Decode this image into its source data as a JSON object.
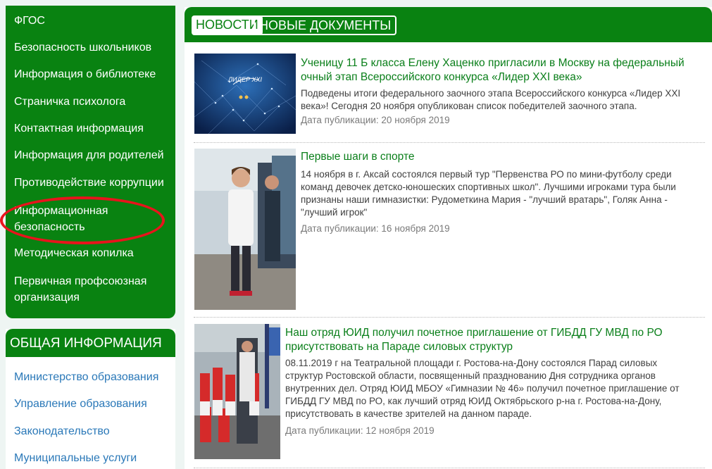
{
  "sidebar": {
    "items": [
      {
        "label": "ФГОС"
      },
      {
        "label": "Безопасность школьников"
      },
      {
        "label": "Информация о библиотеке"
      },
      {
        "label": "Страничка психолога"
      },
      {
        "label": "Контактная информация"
      },
      {
        "label": "Информация для родителей"
      },
      {
        "label": "Противодействие коррупции"
      },
      {
        "label": "Информационная безопасность"
      },
      {
        "label": "Методическая копилка"
      },
      {
        "label": "Первичная профсоюзная организация"
      }
    ]
  },
  "general_info": {
    "title": "ОБЩАЯ ИНФОРМАЦИЯ",
    "items": [
      {
        "label": "Министерство образования"
      },
      {
        "label": "Управление образования"
      },
      {
        "label": "Законодательство"
      },
      {
        "label": "Муниципальные услуги"
      }
    ]
  },
  "tabs": {
    "news": "НОВОСТИ",
    "documents": "НОВЫЕ ДОКУМЕНТЫ"
  },
  "news": [
    {
      "title": "Ученицу 11 Б класса Елену Хаценко пригласили в Москву на федеральный очный этап Всероссийского конкурса «Лидер XXI века»",
      "text": "Подведены итоги федерального заочного этапа Всероссийского конкурса «Лидер XXI века»! Сегодня 20 ноября опубликован список победителей заочного этапа.",
      "date": "Дата публикации: 20 ноября 2019"
    },
    {
      "title": "Первые шаги в спорте",
      "text": "14 ноября в г. Аксай состоялся первый тур \"Первенства РО по мини-футболу среди команд девочек детско-юношеских спортивных школ\". Лучшими игроками тура были признаны наши гимназистки: Рудометкина Мария - \"лучший вратарь\", Голяк Анна - \"лучший игрок\"",
      "date": "Дата публикации: 16 ноября 2019"
    },
    {
      "title": "Наш отряд ЮИД получил почетное приглашение от ГИБДД ГУ МВД по РО присутствовать на Параде силовых структур",
      "text": "08.11.2019 г на Театральной площади г. Ростова-на-Дону состоялся Парад силовых структур Ростовской области, посвященный празднованию Дня сотрудника органов внутренних дел. Отряд ЮИД МБОУ «Гимназии № 46» получил почетное приглашение от ГИБДД ГУ МВД по РО, как лучший отряд ЮИД Октябрьского р-на г. Ростова-на-Дону, присутствовать в качестве зрителей на данном параде.",
      "date": "Дата публикации: 12 ноября 2019"
    }
  ],
  "logo_text": "ЛИДЕР XXI",
  "colors": {
    "brand_green": "#098211",
    "title_green": "#0a7f1a",
    "link_blue": "#2a78b8",
    "highlight_red": "#e8141c"
  }
}
